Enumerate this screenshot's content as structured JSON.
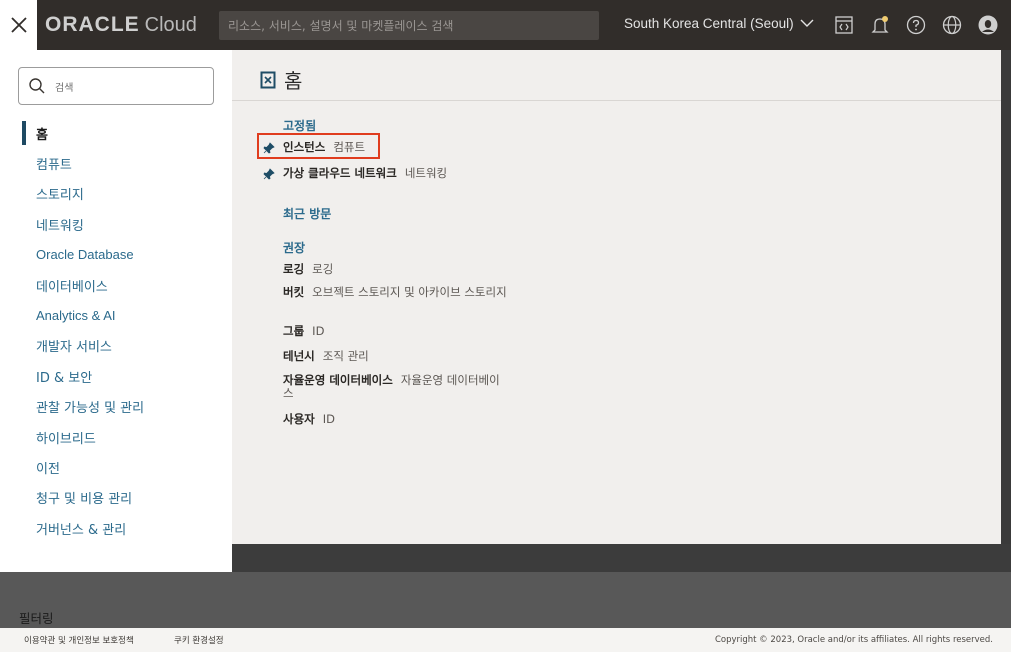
{
  "topbar": {
    "brand": "ORACLE",
    "brand_suffix": "Cloud",
    "search_placeholder": "리소스, 서비스, 설명서 및 마켓플레이스 검색",
    "region": "South Korea Central (Seoul)",
    "icons": [
      "close-icon",
      "cloud-shell-icon",
      "bell-icon",
      "help-icon",
      "globe-icon",
      "user-icon"
    ]
  },
  "sidebar": {
    "search_placeholder": "검색",
    "items": [
      {
        "label": "홈"
      },
      {
        "label": "컴퓨트"
      },
      {
        "label": "스토리지"
      },
      {
        "label": "네트워킹"
      },
      {
        "label": "Oracle Database"
      },
      {
        "label": "데이터베이스"
      },
      {
        "label": "Analytics & AI"
      },
      {
        "label": "개발자 서비스"
      },
      {
        "label": "ID & 보안"
      },
      {
        "label": "관찰 가능성 및 관리"
      },
      {
        "label": "하이브리드"
      },
      {
        "label": "이전"
      },
      {
        "label": "청구 및 비용 관리"
      },
      {
        "label": "거버넌스 & 관리"
      }
    ]
  },
  "main": {
    "title": "홈",
    "pinned_heading": "고정됨",
    "pinned": [
      {
        "name": "인스턴스",
        "category": "컴퓨트"
      },
      {
        "name": "가상 클라우드 네트워크",
        "category": "네트워킹"
      }
    ],
    "recent_heading": "최근 방문",
    "recommended_heading": "권장",
    "recommended": [
      {
        "name": "로깅",
        "category": "로깅"
      },
      {
        "name": "버킷",
        "category": "오브젝트 스토리지 및 아카이브 스토리지"
      },
      {
        "name": "그룹",
        "category": "ID"
      },
      {
        "name": "테넌시",
        "category": "조직 관리"
      },
      {
        "name": "자율운영 데이터베이스",
        "category": "자율운영 데이터베이스"
      },
      {
        "name": "사용자",
        "category": "ID"
      }
    ]
  },
  "filter_label": "필터링",
  "footer": {
    "terms": "이용약관 및 개인정보 보호정책",
    "cookies": "쿠키 환경설정",
    "copyright": "Copyright © 2023, Oracle and/or its affiliates. All rights reserved."
  },
  "colors": {
    "topbar_bg": "#312d2a",
    "link": "#2b6a8c",
    "highlight": "#e03c1e"
  }
}
